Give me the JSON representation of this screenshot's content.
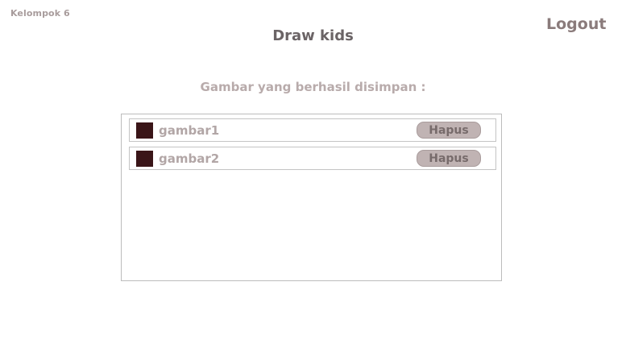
{
  "header": {
    "group_label": "Kelompok 6",
    "app_title": "Draw kids",
    "logout_label": "Logout"
  },
  "main": {
    "subtitle": "Gambar yang berhasil disimpan :",
    "saved_drawings": [
      {
        "name": "gambar1",
        "swatch_color": "#3a1518",
        "delete_label": "Hapus"
      },
      {
        "name": "gambar2",
        "swatch_color": "#3a1518",
        "delete_label": "Hapus"
      }
    ]
  },
  "colors": {
    "button_bg": "#c0b3b3",
    "title_text": "#6b6466",
    "muted_text": "#b8abab"
  }
}
